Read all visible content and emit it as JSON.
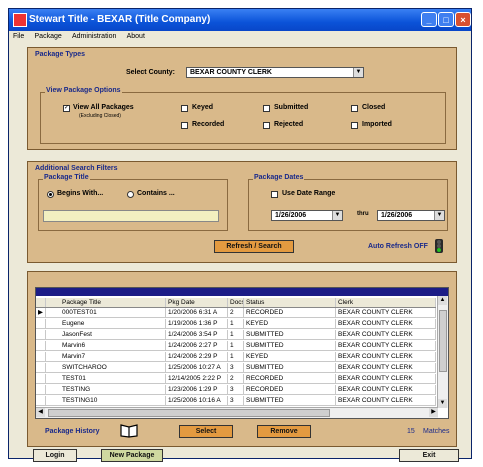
{
  "window": {
    "title": "Stewart Title - BEXAR (Title Company)"
  },
  "menu": [
    "File",
    "Package",
    "Administration",
    "About"
  ],
  "package_types": {
    "group_title": "Package Types",
    "county_label": "Select County:",
    "county_value": "BEXAR COUNTY CLERK",
    "options_title": "View Package Options",
    "view_all": {
      "label": "View All Packages",
      "sub": "(Excluding Closed)",
      "checked": true
    },
    "options": [
      {
        "label": "Keyed",
        "checked": false
      },
      {
        "label": "Submitted",
        "checked": false
      },
      {
        "label": "Closed",
        "checked": false
      },
      {
        "label": "Recorded",
        "checked": false
      },
      {
        "label": "Rejected",
        "checked": false
      },
      {
        "label": "Imported",
        "checked": false
      }
    ]
  },
  "filters": {
    "group_title": "Additional Search Filters",
    "title_group": "Package Title",
    "begins_with": "Begins With...",
    "contains": "Contains ...",
    "dates_group": "Package Dates",
    "use_date_range": "Use Date Range",
    "date_from": "1/26/2006",
    "thru": "thru",
    "date_to": "1/26/2006",
    "refresh_label": "Refresh / Search",
    "auto_refresh": "Auto Refresh OFF"
  },
  "table": {
    "columns": [
      "Package Title",
      "Pkg Date",
      "Docs",
      "Status",
      "Clerk"
    ],
    "rows": [
      [
        "000TEST01",
        "1/20/2006 6:31 A",
        "2",
        "RECORDED",
        "BEXAR COUNTY CLERK"
      ],
      [
        "Eugene",
        "1/19/2006 1:36 P",
        "1",
        "KEYED",
        "BEXAR COUNTY CLERK"
      ],
      [
        "JasonFest",
        "1/24/2006 3:54 P",
        "1",
        "SUBMITTED",
        "BEXAR COUNTY CLERK"
      ],
      [
        "Marvin6",
        "1/24/2006 2:27 P",
        "1",
        "SUBMITTED",
        "BEXAR COUNTY CLERK"
      ],
      [
        "Marvin7",
        "1/24/2006 2:29 P",
        "1",
        "KEYED",
        "BEXAR COUNTY CLERK"
      ],
      [
        "SWITCHAROO",
        "1/25/2006 10:27 A",
        "3",
        "SUBMITTED",
        "BEXAR COUNTY CLERK"
      ],
      [
        "TEST01",
        "12/14/2005 2:22 P",
        "2",
        "RECORDED",
        "BEXAR COUNTY CLERK"
      ],
      [
        "TESTING",
        "1/23/2006 1:29 P",
        "3",
        "RECORDED",
        "BEXAR COUNTY CLERK"
      ],
      [
        "TESTING10",
        "1/25/2006 10:16 A",
        "3",
        "SUBMITTED",
        "BEXAR COUNTY CLERK"
      ]
    ],
    "selected_row": 0
  },
  "bottom": {
    "history_label": "Package History",
    "select_label": "Select",
    "remove_label": "Remove",
    "matches_count": "15",
    "matches_label": "Matches"
  },
  "footer": {
    "login_label": "Login",
    "new_package_label": "New Package",
    "exit_label": "Exit"
  },
  "colors": {
    "panel": "#d9b98a",
    "title_bar": "#0b53d9",
    "group_label": "#1a2a8a",
    "orange_button": "#e39a40"
  }
}
